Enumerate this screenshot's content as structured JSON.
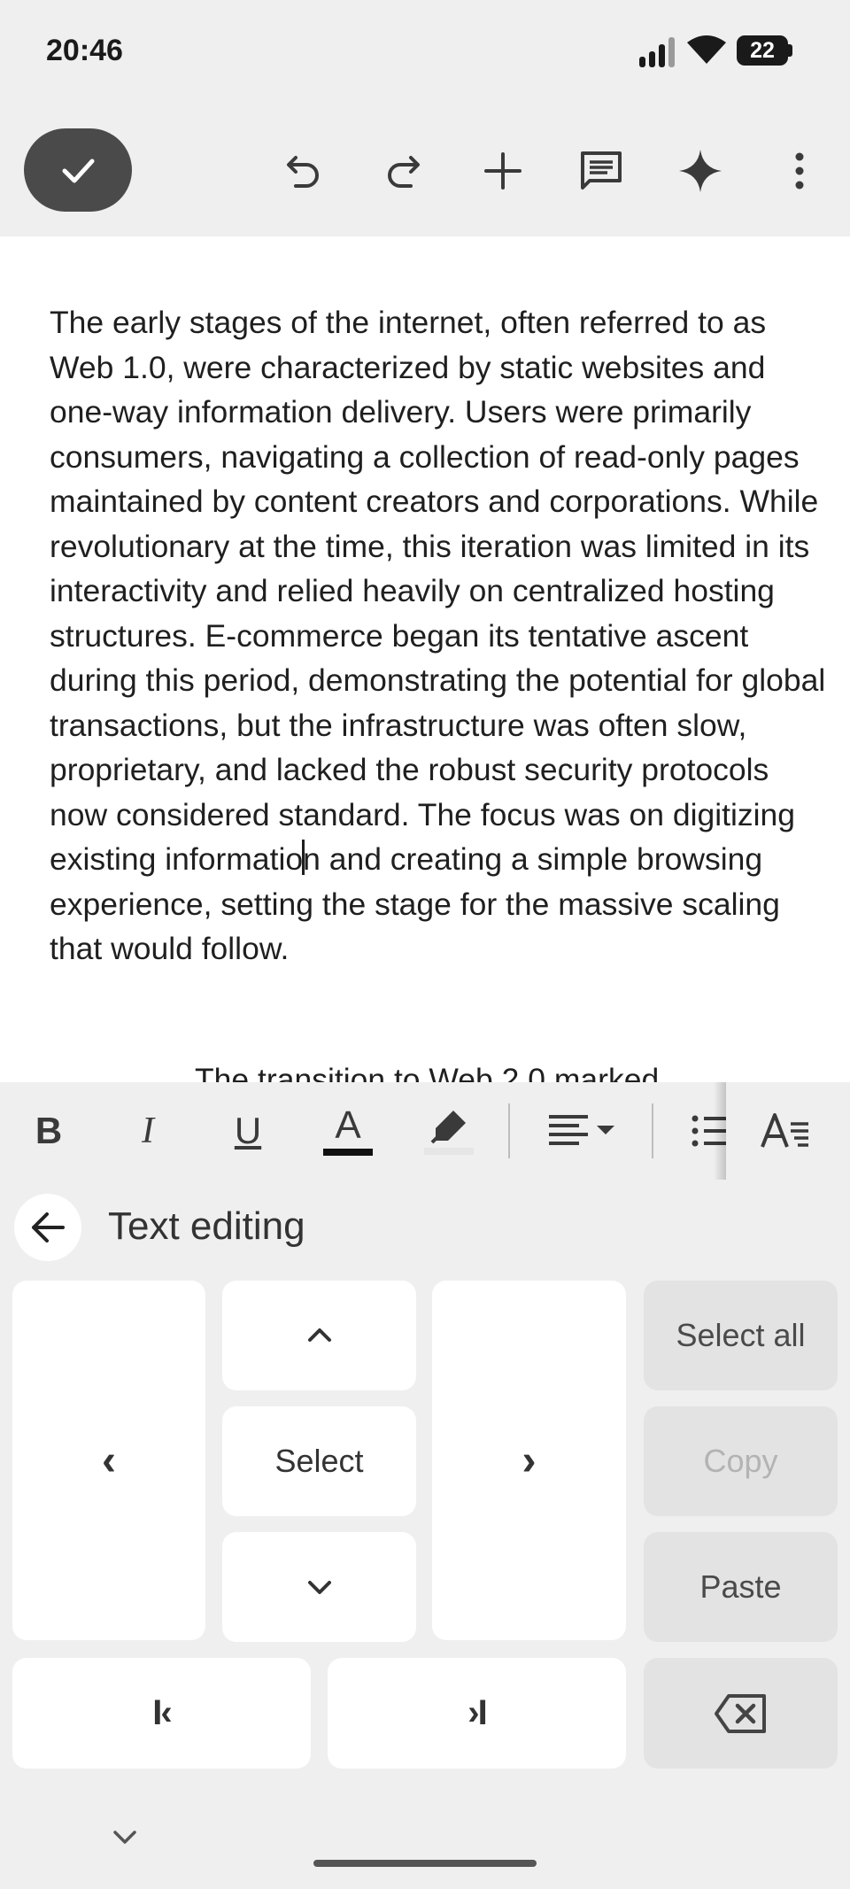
{
  "status_bar": {
    "time": "20:46",
    "battery": "22"
  },
  "toolbar": {
    "icons": [
      "check-icon",
      "undo-icon",
      "redo-icon",
      "plus-icon",
      "comment-icon",
      "sparkle-icon",
      "more-vert-icon"
    ]
  },
  "document": {
    "paragraph_before_cursor": "The early stages of the internet, often referred to as Web 1.0, were characterized by static websites and one-way information delivery. Users were primarily consumers, navigating a collection of read-only pages maintained by content creators and corporations. While revolutionary at the time, this iteration was limited in its interactivity and relied heavily on centralized hosting structures. E-commerce began its tentative ascent during this period, demonstrating the potential for global transactions, but the infrastructure was often slow, proprietary, and lacked the robust security protocols now considered standard. The focus was on digitizing existing informatio",
    "paragraph_after_cursor": "n and creating a simple browsing experience, setting the stage for the massive scaling that would follow.",
    "next_paragraph_partial": "The transition to Web 2.0 marked"
  },
  "format_bar": {
    "bold": "B",
    "italic": "I",
    "underline": "U",
    "text_color": "A",
    "text_color_swatch": "#111111"
  },
  "text_editing": {
    "title": "Text editing",
    "select_label": "Select",
    "select_all_label": "Select all",
    "copy_label": "Copy",
    "paste_label": "Paste",
    "left_glyph": "‹",
    "right_glyph": "›",
    "line_start_glyph": "I‹",
    "line_end_glyph": "›I"
  }
}
